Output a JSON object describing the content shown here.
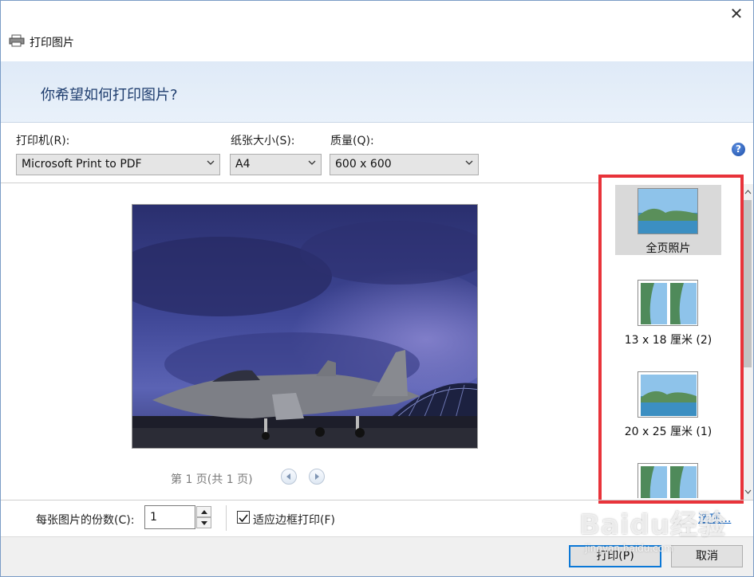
{
  "window": {
    "title": "打印图片",
    "close_icon": "close-icon"
  },
  "header": {
    "question": "你希望如何打印图片?"
  },
  "settings": {
    "printer_label": "打印机(R):",
    "printer_value": "Microsoft Print to PDF",
    "paper_label": "纸张大小(S):",
    "paper_value": "A4",
    "quality_label": "质量(Q):",
    "quality_value": "600 x 600",
    "help": "?"
  },
  "preview": {
    "page_indicator": "第 1 页(共 1 页)",
    "prev_icon": "arrow-left-icon",
    "next_icon": "arrow-right-icon"
  },
  "layouts": {
    "items": [
      {
        "label": "全页照片",
        "selected": true
      },
      {
        "label": "13 x 18 厘米 (2)",
        "selected": false
      },
      {
        "label": "20 x 25 厘米 (1)",
        "selected": false
      },
      {
        "label": "",
        "selected": false
      }
    ]
  },
  "bottom": {
    "copies_label": "每张图片的份数(C):",
    "copies_value": "1",
    "fit_label": "适应边框打印(F)",
    "fit_checked": true,
    "options_link": "选项..."
  },
  "buttons": {
    "print": "打印(P)",
    "cancel": "取消"
  },
  "watermark": {
    "text": "Baidu经验",
    "sub": "jingyan.baidu.com"
  },
  "colors": {
    "highlight_border": "#e8333a",
    "header_bg": "#e3edf8",
    "link": "#0b5fbf"
  }
}
